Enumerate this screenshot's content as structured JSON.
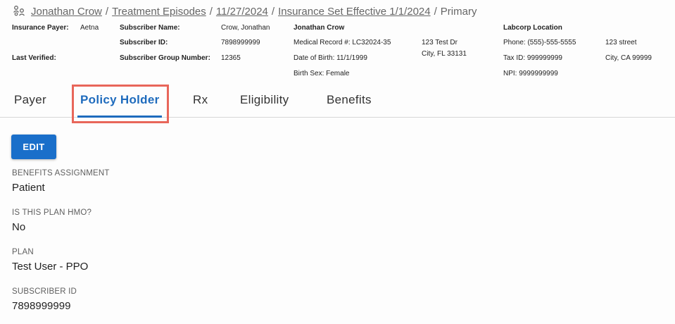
{
  "breadcrumb": {
    "icon": "people-group-icon",
    "items": [
      "Jonathan Crow",
      "Treatment Episodes",
      "11/27/2024",
      "Insurance Set Effective 1/1/2024"
    ],
    "current": "Primary",
    "separator": "/"
  },
  "header": {
    "insurance_payer_label": "Insurance Payer:",
    "insurance_payer_value": "Aetna",
    "last_verified_label": "Last Verified:",
    "subscriber_name_label": "Subscriber Name:",
    "subscriber_name_value": "Crow, Jonathan",
    "subscriber_id_label": "Subscriber ID:",
    "subscriber_id_value": "7898999999",
    "subscriber_group_label": "Subscriber Group Number:",
    "subscriber_group_value": "12365",
    "patient": {
      "name": "Jonathan Crow",
      "medical_record": "Medical Record #: LC32024-35",
      "dob": "Date of Birth: 11/1/1999",
      "birth_sex": "Birth Sex: Female",
      "address_line1": "123 Test Dr",
      "address_line2": "City, FL 33131"
    },
    "location": {
      "name": "Labcorp Location",
      "phone": "Phone: (555)-555-5555",
      "tax_id": "Tax ID: 999999999",
      "npi": "NPI: 9999999999",
      "address_line1": "123 street",
      "address_line2": "City, CA 99999"
    }
  },
  "tabs": [
    {
      "label": "Payer",
      "active": false
    },
    {
      "label": "Policy Holder",
      "active": true
    },
    {
      "label": "Rx",
      "active": false
    },
    {
      "label": "Eligibility",
      "active": false
    },
    {
      "label": "Benefits",
      "active": false
    }
  ],
  "edit_label": "EDIT",
  "fields": [
    {
      "label": "BENEFITS ASSIGNMENT",
      "value": "Patient"
    },
    {
      "label": "IS THIS PLAN HMO?",
      "value": "No"
    },
    {
      "label": "PLAN",
      "value": "Test User - PPO"
    },
    {
      "label": "SUBSCRIBER ID",
      "value": "7898999999"
    }
  ],
  "colors": {
    "accent": "#1e6bbd",
    "button": "#1a6fca",
    "highlight_box": "#e8665a"
  }
}
